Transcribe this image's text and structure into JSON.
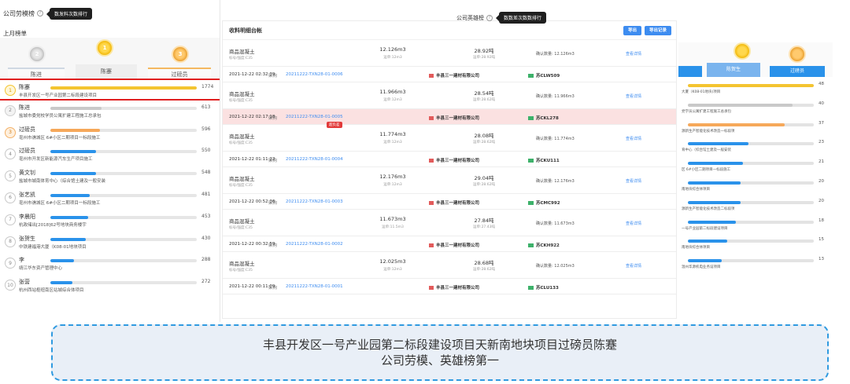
{
  "left": {
    "title": "公司劳模榜",
    "help": "?",
    "tooltip": "数发料次数排行",
    "subtitle": "上月榜单",
    "medal_labels": [
      "2",
      "1",
      "3"
    ],
    "podium_tabs": {
      "second": "陈进",
      "first": "陈蹇",
      "third": "过磅员"
    },
    "ranks": [
      {
        "rank": "1",
        "name": "陈蹇",
        "project": "丰县开发区一号产业园第二标段建设项目",
        "value": "1774",
        "fill": 1.0,
        "color": "#f4c430",
        "badge": "gold"
      },
      {
        "rank": "2",
        "name": "陈进",
        "project": "盐城市委党校学员公寓扩建工程施工总承包",
        "value": "613",
        "fill": 0.35,
        "color": "#c9c9c9",
        "badge": "silver"
      },
      {
        "rank": "3",
        "name": "过磅员",
        "project": "亳州市谯城区 6#小区二期项目一标段施工",
        "value": "596",
        "fill": 0.34,
        "color": "#f6a85a",
        "badge": "bronze"
      },
      {
        "rank": "4",
        "name": "过磅员",
        "project": "亳州市开发区新能源汽车生产项目施工",
        "value": "550",
        "fill": 0.31,
        "color": "#2a92ea",
        "badge": ""
      },
      {
        "rank": "5",
        "name": "黄文钊",
        "project": "盐城市城南体育中心（综合馆土建及一般安装",
        "value": "548",
        "fill": 0.31,
        "color": "#2a92ea",
        "badge": ""
      },
      {
        "rank": "6",
        "name": "张艺凯",
        "project": "亳州市谯城区 6#小区二期项目一标段施工",
        "value": "481",
        "fill": 0.27,
        "color": "#2a92ea",
        "badge": ""
      },
      {
        "rank": "7",
        "name": "李晨阳",
        "project": "杭政储出[2018]62号地块商务楼宇",
        "value": "453",
        "fill": 0.26,
        "color": "#2a92ea",
        "badge": ""
      },
      {
        "rank": "8",
        "name": "张贺生",
        "project": "中铁建福港大厦（K08-01地块项目",
        "value": "430",
        "fill": 0.24,
        "color": "#2a92ea",
        "badge": ""
      },
      {
        "rank": "9",
        "name": "李",
        "project": "靖江华东资产管理中心",
        "value": "288",
        "fill": 0.16,
        "color": "#2a92ea",
        "badge": ""
      },
      {
        "rank": "10",
        "name": "张营",
        "project": "杭州西站枢纽南区站城综合体项目",
        "value": "272",
        "fill": 0.15,
        "color": "#2a92ea",
        "badge": ""
      }
    ]
  },
  "middle": {
    "title": "收料明细台帐",
    "btn_primary": "导出",
    "btn_secondary": "导出记录",
    "orders": [
      {
        "time": "",
        "tag": "",
        "no": "",
        "company": "",
        "plate": "",
        "name": "商品混凝土",
        "grade": "标号/强度:C35",
        "v1": "12.126m3",
        "v1s": "运单:12m3",
        "v2": "28.92吨",
        "v2s": "运单:28.92吨",
        "confirm": "确认数量: 12.126m3",
        "link": "查看详情",
        "warn": "",
        "hl": false
      },
      {
        "time": "2021-12-22 02:32:39",
        "tag": "采购",
        "no": "20211222-TXN28-01-0006",
        "company": "丰县三一建材有限公司",
        "plate": "苏CLW509",
        "name": "商品混凝土",
        "grade": "标号/强度:C35",
        "v1": "11.966m3",
        "v1s": "运单:12m3",
        "v2": "28.54吨",
        "v2s": "运单:28.62吨",
        "confirm": "确认数量: 11.966m3",
        "link": "查看详情",
        "warn": "",
        "hl": false
      },
      {
        "time": "2021-12-22 02:17:18",
        "tag": "采购",
        "no": "20211222-TXN28-01-0005",
        "company": "丰县三一建材有限公司",
        "plate": "苏CKL278",
        "name": "商品混凝土",
        "grade": "标号/强度:C35",
        "v1": "11.774m3",
        "v1s": "运单:12m3",
        "v2": "28.08吨",
        "v2s": "运单:28.62吨",
        "confirm": "确认数量: 11.774m3",
        "link": "查看详情",
        "warn": "超负差",
        "hl": true
      },
      {
        "time": "2021-12-22 01:11:22",
        "tag": "采购",
        "no": "20211222-TXN28-01-0004",
        "company": "丰县三一建材有限公司",
        "plate": "苏CKU111",
        "name": "商品混凝土",
        "grade": "标号/强度:C35",
        "v1": "12.176m3",
        "v1s": "运单:12m3",
        "v2": "29.04吨",
        "v2s": "运单:28.62吨",
        "confirm": "确认数量: 12.176m3",
        "link": "查看详情",
        "warn": "",
        "hl": false
      },
      {
        "time": "2021-12-22 00:52:36",
        "tag": "采购",
        "no": "20211222-TXN28-01-0003",
        "company": "丰县三一建材有限公司",
        "plate": "苏CMC992",
        "name": "商品混凝土",
        "grade": "标号/强度:C35",
        "v1": "11.673m3",
        "v1s": "运单:11.5m3",
        "v2": "27.84吨",
        "v2s": "运单:27.43吨",
        "confirm": "确认数量: 11.673m3",
        "link": "查看详情",
        "warn": "",
        "hl": false
      },
      {
        "time": "2021-12-22 00:32:59",
        "tag": "采购",
        "no": "20211222-TXN28-01-0002",
        "company": "丰县三一建材有限公司",
        "plate": "苏CKH922",
        "name": "商品混凝土",
        "grade": "标号/强度:C35",
        "v1": "12.025m3",
        "v1s": "运单:12m3",
        "v2": "28.68吨",
        "v2s": "运单:28.62吨",
        "confirm": "确认数量: 12.025m3",
        "link": "查看详情",
        "warn": "",
        "hl": false
      }
    ],
    "last_order": {
      "time": "2021-12-22 00:11:09",
      "tag": "采购",
      "no": "20211222-TXN28-01-0001",
      "company": "丰县三一建材有限公司",
      "plate": "苏CLU133"
    }
  },
  "right": {
    "title": "公司英雄榜",
    "help": "?",
    "tooltip": "数数差次数数排行",
    "podium_tabs": {
      "left": "",
      "first": "陈贺生",
      "third": "过磅员"
    },
    "items": [
      {
        "value": "48",
        "fill": 1.0,
        "color": "#f4c430",
        "project": "大厦（K08-01地块)项目"
      },
      {
        "value": "40",
        "fill": 0.83,
        "color": "#c9c9c9",
        "project": "党学员公寓扩建工程施工总承包"
      },
      {
        "value": "37",
        "fill": 0.77,
        "color": "#f6a85a",
        "project": "源新生产智能化技术改造一标段项"
      },
      {
        "value": "23",
        "fill": 0.48,
        "color": "#2a92ea",
        "project": "育中心（综合馆土建及一般安装"
      },
      {
        "value": "21",
        "fill": 0.44,
        "color": "#2a92ea",
        "project": "区 6#小区二期项目一标段施工"
      },
      {
        "value": "20",
        "fill": 0.42,
        "color": "#2a92ea",
        "project": "南地块综合体项目"
      },
      {
        "value": "20",
        "fill": 0.42,
        "color": "#2a92ea",
        "project": "源新生产智能化技术改造二标段项"
      },
      {
        "value": "18",
        "fill": 0.38,
        "color": "#2a92ea",
        "project": "一号产业园第二标段建设项目"
      },
      {
        "value": "15",
        "fill": 0.31,
        "color": "#2a92ea",
        "project": "南地块综合体项目"
      },
      {
        "value": "13",
        "fill": 0.27,
        "color": "#2a92ea",
        "project": "温州华源机电业务设项目"
      }
    ]
  },
  "caption": {
    "line1": "丰县开发区一号产业园第二标段建设项目天新南地块项目过磅员陈蹇",
    "line2": "公司劳模、英雄榜第一"
  }
}
